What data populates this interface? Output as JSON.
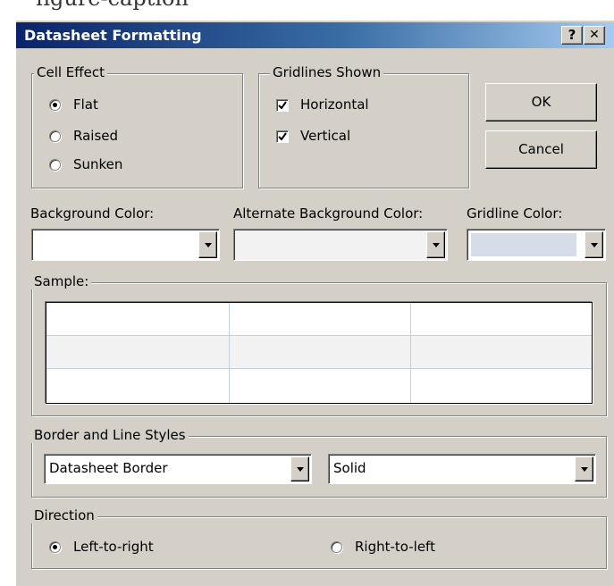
{
  "dialog": {
    "title": "Datasheet Formatting",
    "help_button": "?",
    "close_button": "✕"
  },
  "cell_effect": {
    "label": "Cell Effect",
    "options": [
      {
        "label": "Flat",
        "selected": true
      },
      {
        "label": "Raised",
        "selected": false
      },
      {
        "label": "Sunken",
        "selected": false
      }
    ]
  },
  "gridlines_shown": {
    "label": "Gridlines Shown",
    "options": [
      {
        "label": "Horizontal",
        "checked": true
      },
      {
        "label": "Vertical",
        "checked": true
      }
    ]
  },
  "buttons": {
    "ok": "OK",
    "cancel": "Cancel"
  },
  "colors": {
    "background_color": {
      "label": "Background Color:",
      "value_hex": "#ffffff"
    },
    "alternate_background_color": {
      "label": "Alternate Background Color:",
      "value_hex": "#f2f2f2"
    },
    "gridline_color": {
      "label": "Gridline Color:",
      "value_hex": "#d6dde9"
    }
  },
  "sample": {
    "label": "Sample:",
    "rows": 3,
    "columns": 3,
    "row_colors": [
      "#ffffff",
      "#f2f2f2",
      "#ffffff"
    ],
    "gridline_color": "#c3cfe0"
  },
  "border_line_styles": {
    "label": "Border and Line Styles",
    "border_select": "Datasheet Border",
    "line_style_select": "Solid"
  },
  "direction": {
    "label": "Direction",
    "options": [
      {
        "label": "Left-to-right",
        "selected": true
      },
      {
        "label": "Right-to-left",
        "selected": false
      }
    ]
  }
}
